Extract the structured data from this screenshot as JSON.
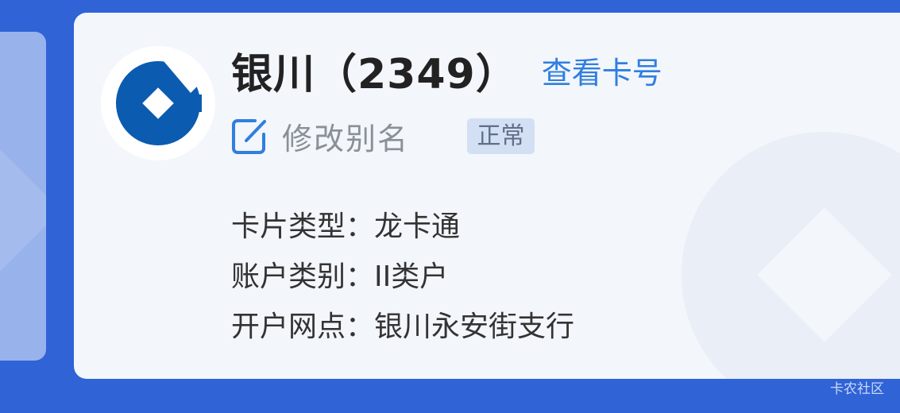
{
  "card": {
    "bank_name": "银川（2349）",
    "view_card_number": "查看卡号",
    "edit_alias": "修改别名",
    "status": "正常",
    "details": [
      {
        "label": "卡片类型：",
        "value": "龙卡通"
      },
      {
        "label": "账户类别：",
        "value": "II类户"
      },
      {
        "label": "开户网点：",
        "value": "银川永安街支行"
      }
    ]
  },
  "credit": "卡农社区",
  "colors": {
    "background": "#2f63d6",
    "card": "#f3f6fb",
    "brand": "#0b5bb0",
    "link": "#2f7fe0",
    "status_badge": "#d3e0f3"
  },
  "icons": {
    "bank_logo": "ccb-logo",
    "edit": "edit-icon"
  }
}
